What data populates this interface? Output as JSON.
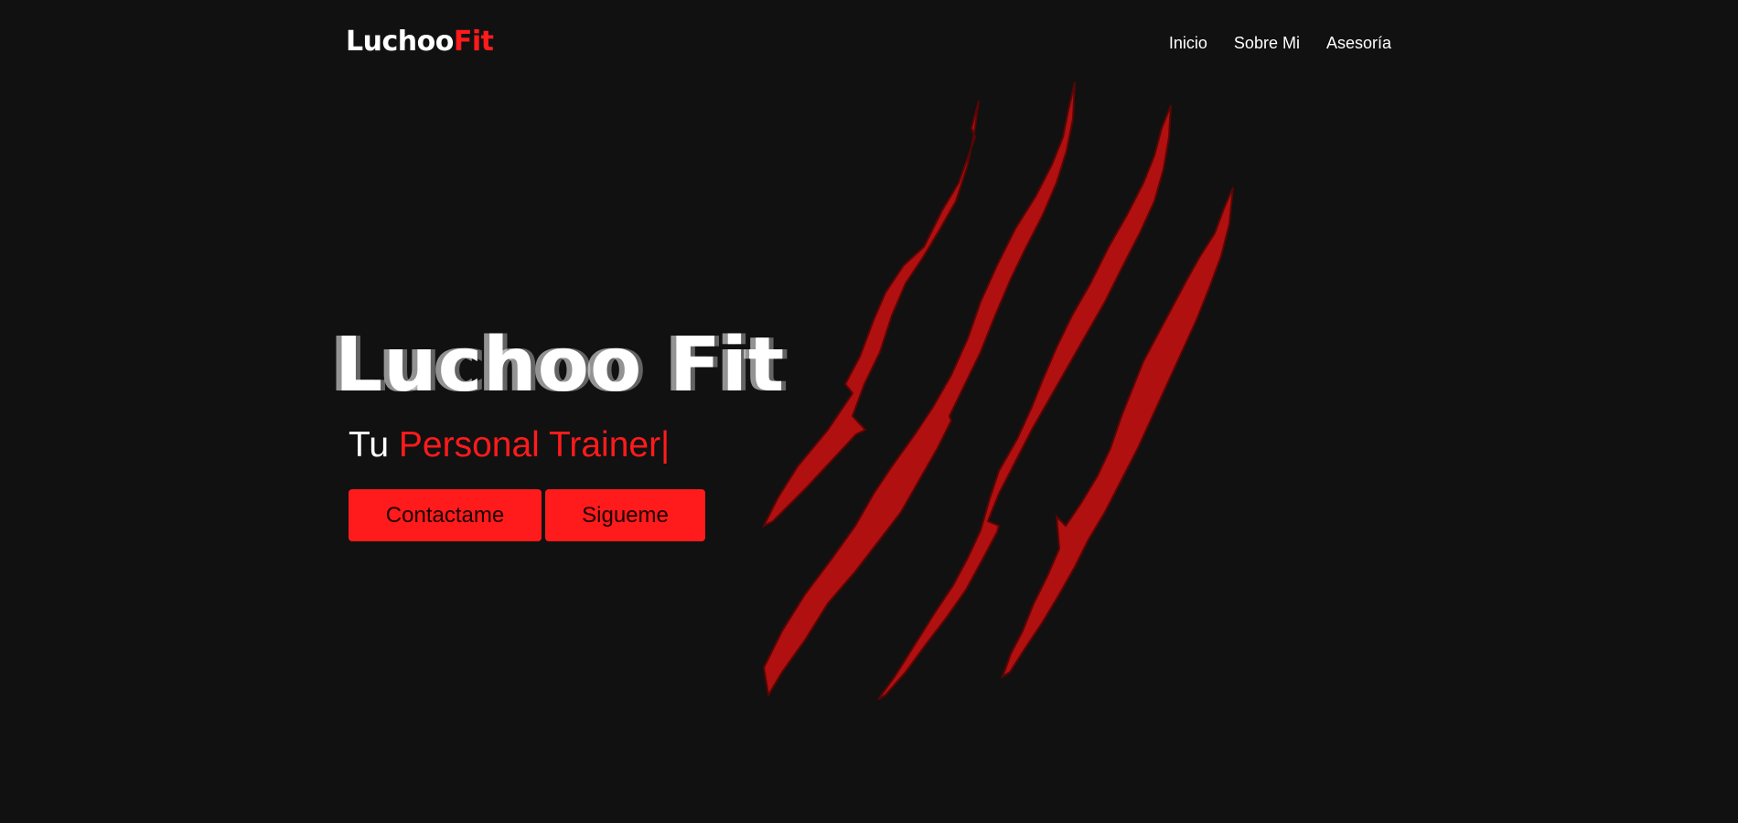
{
  "navbar": {
    "logo": {
      "part1": "Luchoo",
      "part2": "Fit"
    },
    "links": [
      "Inicio",
      "Sobre Mi",
      "Asesoría"
    ]
  },
  "hero": {
    "title": "Luchoo Fit",
    "tagline_prefix": "Tu",
    "tagline_role": "Personal Trainer|",
    "buttons": {
      "contact": "Contactame",
      "follow": "Sigueme"
    }
  },
  "colors": {
    "background": "#111111",
    "accent": "#ff1b1b",
    "claw": "#b01010",
    "text": "#ffffff"
  },
  "decoration": {
    "claw_marks": "claw-scratch-graphic"
  }
}
